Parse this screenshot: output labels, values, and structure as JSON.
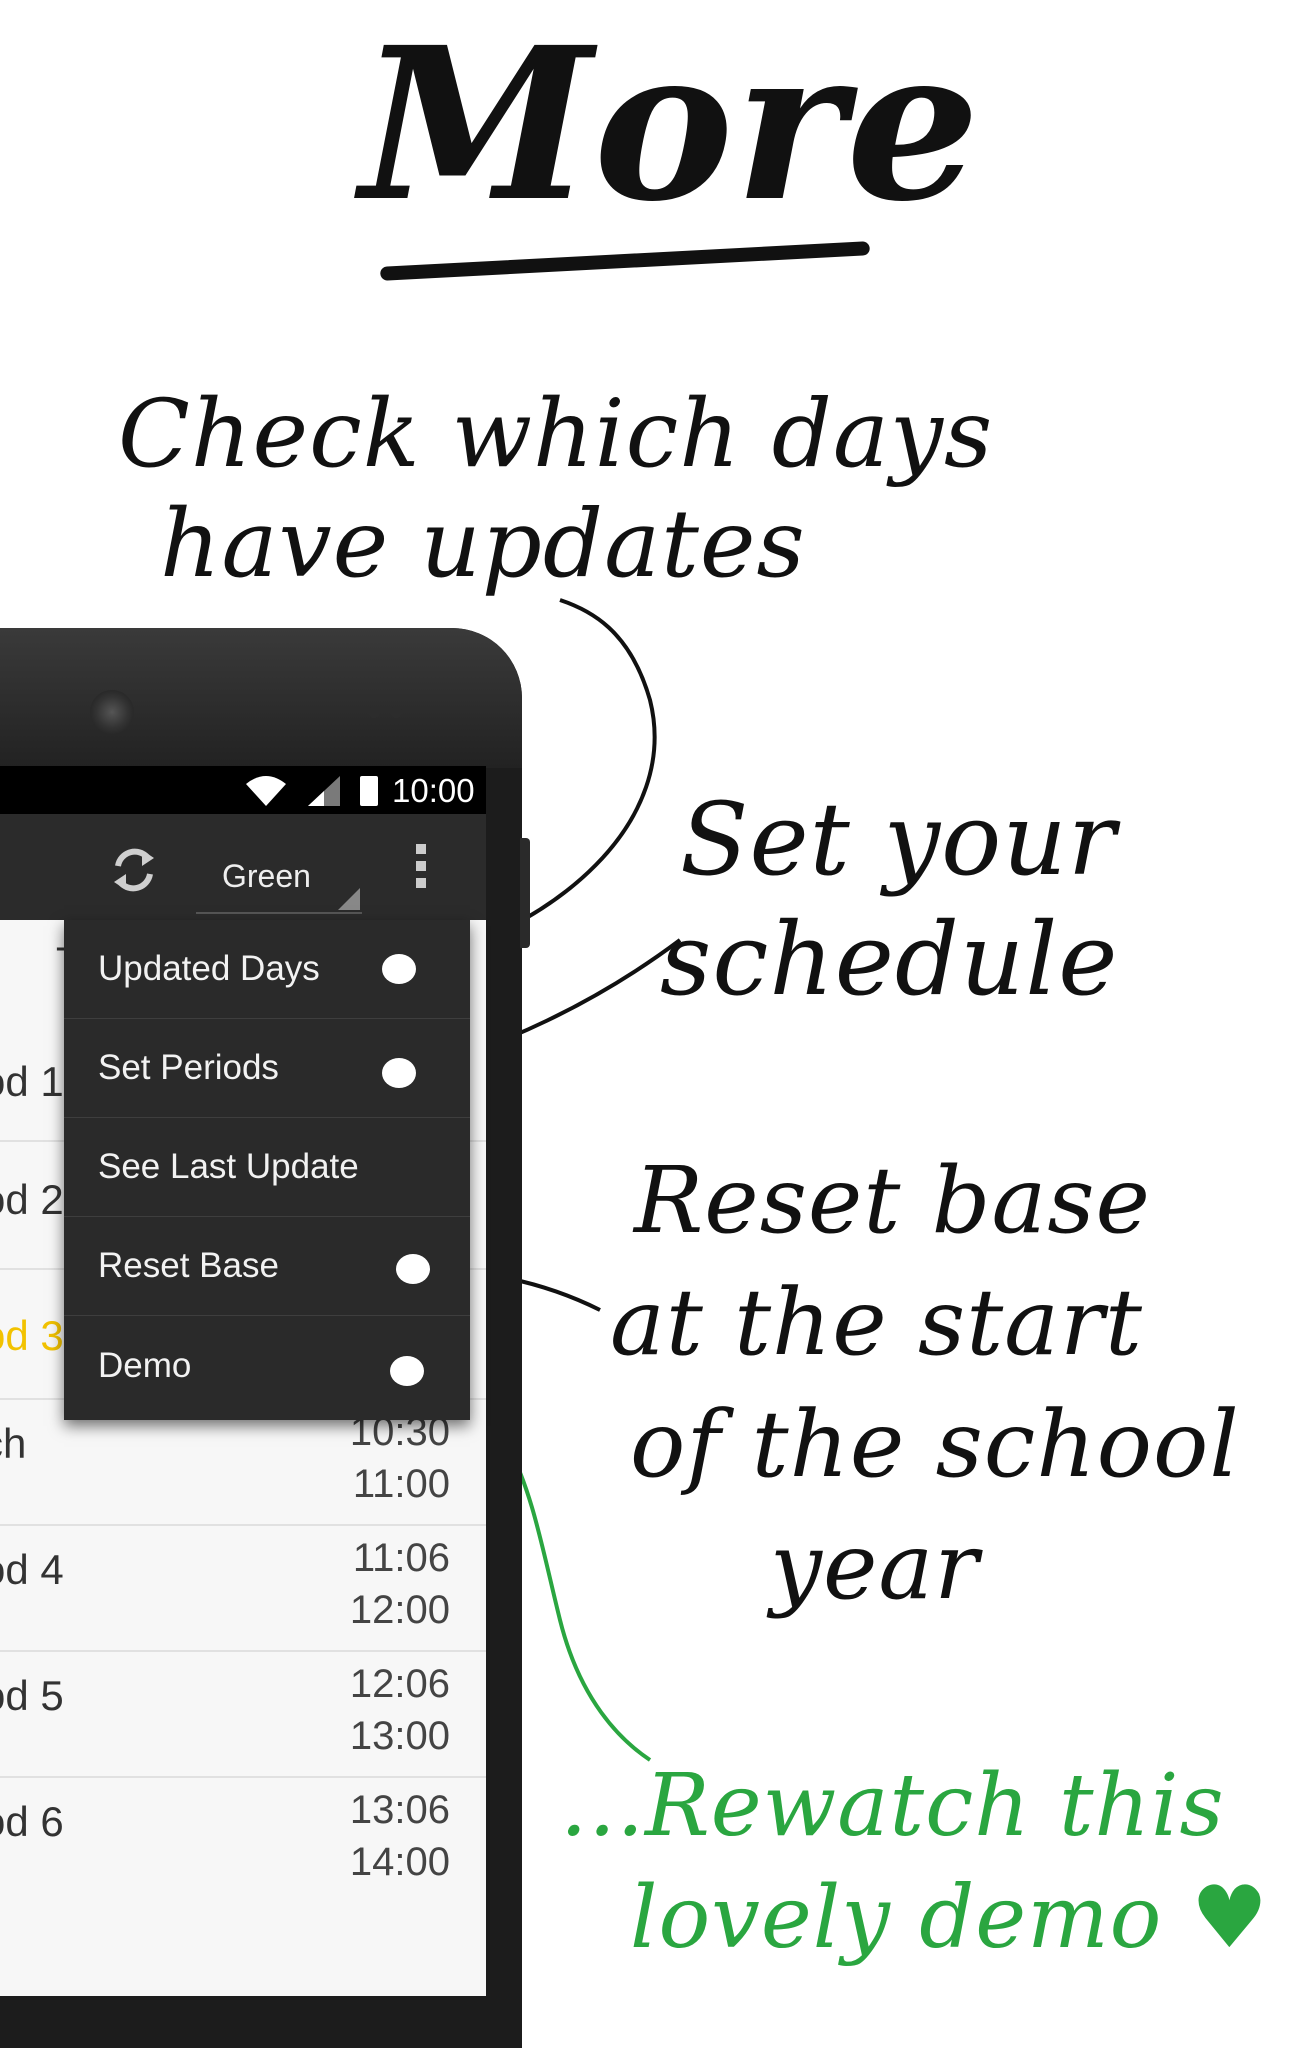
{
  "annotations": {
    "title": "More",
    "check_days": [
      "Check which days",
      "have updates"
    ],
    "set_schedule": [
      "Set your",
      "schedule"
    ],
    "reset_base": [
      "Reset base",
      "at the start",
      "of the school",
      "year"
    ],
    "rewatch": [
      "...Rewatch this",
      "lovely demo"
    ]
  },
  "status_bar": {
    "time": "10:00"
  },
  "action_bar": {
    "schedule_selector": "Green"
  },
  "menu": {
    "items": [
      "Updated Days",
      "Set Periods",
      "See Last Update",
      "Reset Base",
      "Demo"
    ]
  },
  "list": {
    "partial_header": "T",
    "rows": [
      {
        "name": "od 1",
        "start": "",
        "end": ""
      },
      {
        "name": "od 2",
        "start": "",
        "end": ""
      },
      {
        "name": "od 3",
        "start": "",
        "end": "",
        "highlight": true
      },
      {
        "name": "ch",
        "start": "10:30",
        "end": "11:00"
      },
      {
        "name": "od 4",
        "start": "11:06",
        "end": "12:00"
      },
      {
        "name": "od 5",
        "start": "12:06",
        "end": "13:00"
      },
      {
        "name": "od 6",
        "start": "13:06",
        "end": "14:00"
      }
    ]
  },
  "colors": {
    "highlight": "#f2c200",
    "handwriting_green": "#2aa640",
    "ink": "#111111"
  },
  "icons": [
    "wifi-icon",
    "signal-icon",
    "battery-icon",
    "refresh-icon",
    "overflow-menu-icon",
    "dropdown-corner-icon",
    "heart-icon"
  ]
}
